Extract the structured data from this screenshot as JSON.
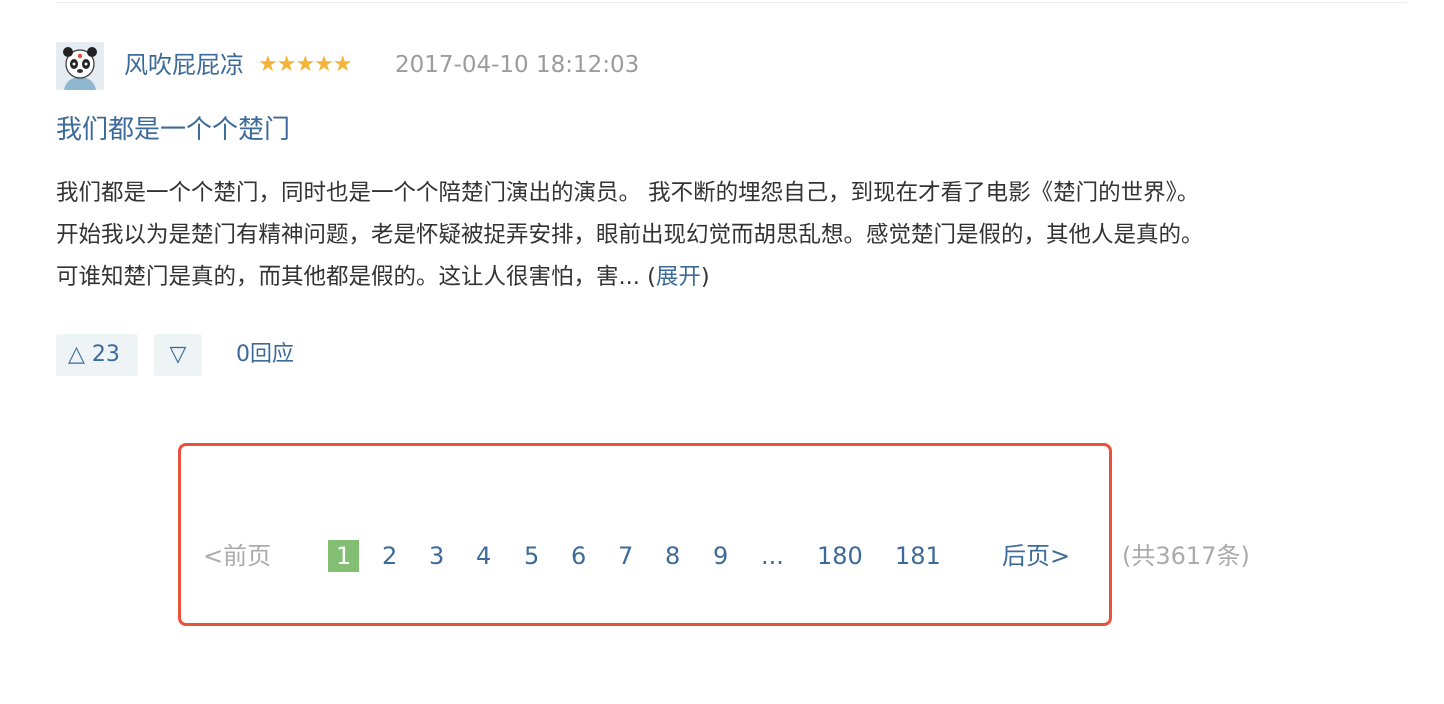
{
  "review": {
    "author": "风吹屁屁凉",
    "rating_stars": 5,
    "stars_text": "★★★★★",
    "timestamp": "2017-04-10 18:12:03",
    "title": "我们都是一个个楚门",
    "body_lines": [
      "我们都是一个个楚门，同时也是一个个陪楚门演出的演员。 我不断的埋怨自己，到现在才看了电影《楚门的世界》。",
      "开始我以为是楚门有精神问题，老是怀疑被捉弄安排，眼前出现幻觉而胡思乱想。感觉楚门是假的，其他人是真的。",
      "可谁知楚门是真的，而其他都是假的。这让人很害怕，害..."
    ],
    "expand_open": "(",
    "expand_label": "展开",
    "expand_close": ")",
    "upvote_icon": "△",
    "upvote_count": "23",
    "downvote_icon": "▽",
    "replies_label": "0回应"
  },
  "pagination": {
    "prev_label": "<前页",
    "current_page": "1",
    "pages": [
      "2",
      "3",
      "4",
      "5",
      "6",
      "7",
      "8",
      "9"
    ],
    "ellipsis": "...",
    "tail_pages": [
      "180",
      "181"
    ],
    "next_label": "后页>",
    "total_label": "(共3617条)"
  },
  "colors": {
    "link": "#3d6b99",
    "star": "#f4b43a",
    "current_page_bg": "#83bf73",
    "highlight_border": "#e8523a"
  }
}
